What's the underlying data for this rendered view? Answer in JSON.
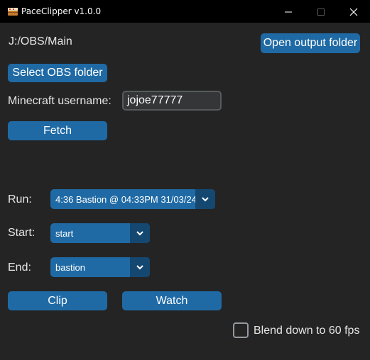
{
  "window": {
    "title": "PaceClipper v1.0.0",
    "app_icon": "minecraft-cake-icon",
    "controls": {
      "minimize": "minimize-icon",
      "maximize": "maximize-icon",
      "close": "close-icon"
    }
  },
  "obs_path": "J:/OBS/Main",
  "buttons": {
    "open_output": "Open output folder",
    "select_obs": "Select OBS folder",
    "fetch": "Fetch",
    "clip": "Clip",
    "watch": "Watch"
  },
  "username": {
    "label": "Minecraft username:",
    "value": "jojoe77777"
  },
  "run": {
    "label": "Run:",
    "selected": "4:36 Bastion @ 04:33PM 31/03/24"
  },
  "start": {
    "label": "Start:",
    "selected": "start"
  },
  "end": {
    "label": "End:",
    "selected": "bastion"
  },
  "blend": {
    "label": "Blend down to 60 fps",
    "checked": false
  },
  "colors": {
    "accent": "#1f6aa5",
    "accent_dark": "#144870",
    "background": "#242424",
    "titlebar": "#000000"
  }
}
